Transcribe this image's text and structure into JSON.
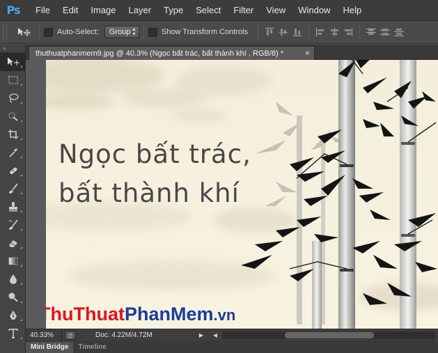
{
  "app": {
    "logo": "Ps"
  },
  "menu": [
    "File",
    "Edit",
    "Image",
    "Layer",
    "Type",
    "Select",
    "Filter",
    "View",
    "Window",
    "Help"
  ],
  "options_bar": {
    "auto_select_label": "Auto-Select:",
    "auto_select_value": "Group",
    "show_transform_label": "Show Transform Controls"
  },
  "document": {
    "tab_title": "thuthuatphanmem9.jpg @ 40.3% (Ngọc bất trác, bất thành khí , RGB/8) *",
    "close_glyph": "×"
  },
  "canvas": {
    "text_line_1": "Ngọc bất trác,",
    "text_line_2": "bất thành khí",
    "watermark_part_1": "ThuThuat",
    "watermark_part_2": "PhanMem",
    "watermark_part_3": ".vn"
  },
  "status": {
    "zoom": "40.33%",
    "doc_info": "Doc: 4.22M/4.72M"
  },
  "panels": {
    "tab_1": "Mini Bridge",
    "tab_2": "Timeline"
  },
  "colors": {
    "canvas_bg": "#f6f0de",
    "ink": "#141414",
    "watermark_red": "#e3121b",
    "watermark_blue": "#1a3d9c",
    "ps_blue": "#4fa3e8"
  }
}
